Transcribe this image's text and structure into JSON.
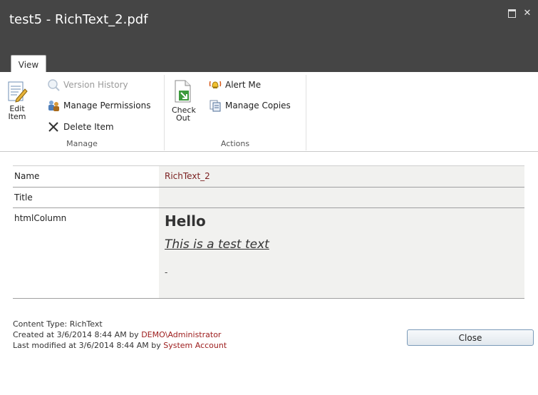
{
  "window": {
    "title": "test5 - RichText_2.pdf",
    "maximize_label": "",
    "close_glyph": "✕"
  },
  "tabs": {
    "view": "View"
  },
  "ribbon": {
    "manage": {
      "edit_item": [
        "Edit",
        "Item"
      ],
      "version_history": "Version History",
      "manage_permissions": "Manage Permissions",
      "delete_item": "Delete Item",
      "group_label": "Manage"
    },
    "actions": {
      "check_out": [
        "Check",
        "Out"
      ],
      "alert_me": "Alert Me",
      "manage_copies": "Manage Copies",
      "group_label": "Actions"
    }
  },
  "properties": {
    "name_label": "Name",
    "name_value": "RichText_2",
    "title_label": "Title",
    "title_value": "",
    "html_label": "htmlColumn",
    "html_heading": "Hello",
    "html_text": "This is a test text",
    "html_dash": "-"
  },
  "footer": {
    "content_type": "Content Type: RichText",
    "created_prefix": "Created at 3/6/2014 8:44 AM by ",
    "created_by": "DEMO\\Administrator",
    "modified_prefix": "Last modified at 3/6/2014 8:44 AM by ",
    "modified_by": "System Account",
    "close_label": "Close"
  }
}
